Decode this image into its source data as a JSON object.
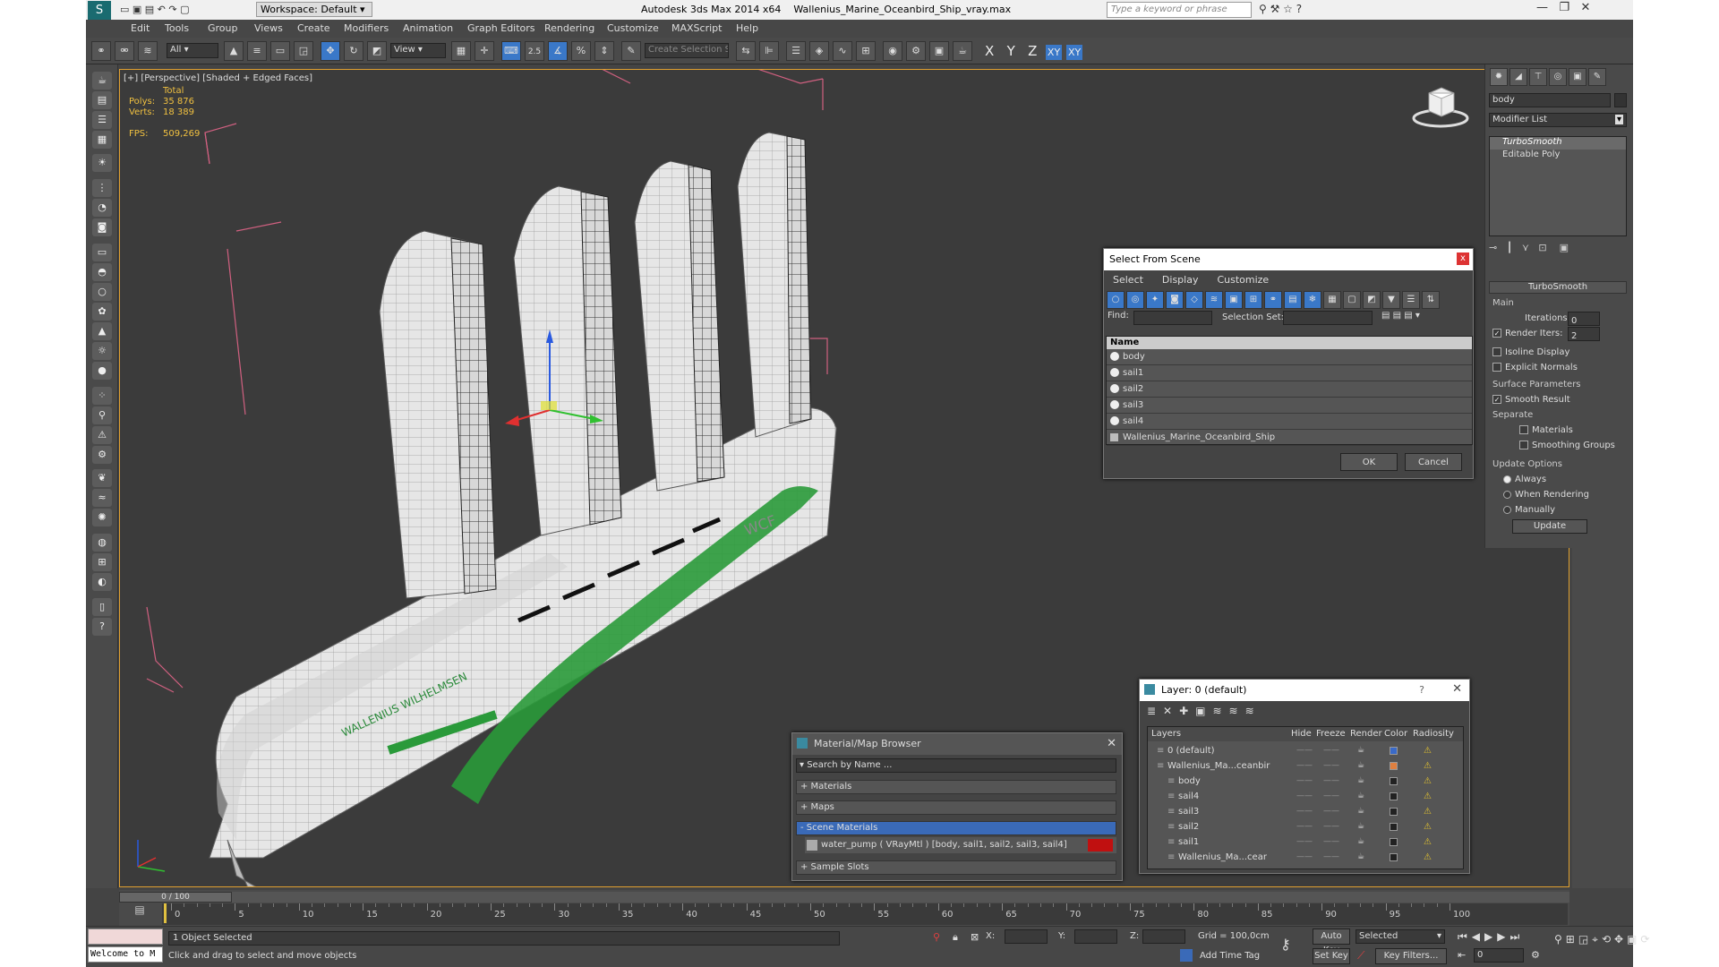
{
  "window": {
    "app_title": "Autodesk 3ds Max  2014 x64",
    "file_title": "Wallenius_Marine_Oceanbird_Ship_vray.max",
    "workspace": "Workspace: Default",
    "search_placeholder": "Type a keyword or phrase"
  },
  "menu": [
    "Edit",
    "Tools",
    "Group",
    "Views",
    "Create",
    "Modifiers",
    "Animation",
    "Graph Editors",
    "Rendering",
    "Customize",
    "MAXScript",
    "Help"
  ],
  "toolbar": {
    "filter": "All",
    "ref_coord": "View",
    "angle_snap": "2.5",
    "selection_set": "Create Selection Se",
    "axes": [
      "X",
      "Y",
      "Z",
      "XY",
      "XY"
    ]
  },
  "viewport": {
    "label": "[+] [Perspective] [Shaded + Edged Faces]",
    "stats": {
      "header": "Total",
      "polys_label": "Polys:",
      "polys": "35 876",
      "verts_label": "Verts:",
      "verts": "18 389",
      "fps_label": "FPS:",
      "fps": "509,269"
    },
    "logo_text": "WALLENIUS WILHELMSEN",
    "hull_text": "WCF"
  },
  "select_dialog": {
    "title": "Select From Scene",
    "tabs": [
      "Select",
      "Display",
      "Customize"
    ],
    "find_label": "Find:",
    "selset_label": "Selection Set:",
    "column": "Name",
    "items": [
      "body",
      "sail1",
      "sail2",
      "sail3",
      "sail4",
      "Wallenius_Marine_Oceanbird_Ship"
    ],
    "ok": "OK",
    "cancel": "Cancel"
  },
  "command_panel": {
    "object_name": "body",
    "modifier_list": "Modifier List",
    "stack": [
      "TurboSmooth",
      "Editable Poly"
    ],
    "rollout": "TurboSmooth",
    "main": "Main",
    "iterations_label": "Iterations:",
    "iterations": "0",
    "render_iters_label": "Render Iters:",
    "render_iters": "2",
    "isoline": "Isoline Display",
    "explicit_normals": "Explicit Normals",
    "surface_params": "Surface Parameters",
    "smooth_result": "Smooth Result",
    "separate": "Separate",
    "materials": "Materials",
    "smoothing_groups": "Smoothing Groups",
    "update_options": "Update Options",
    "always": "Always",
    "when_rendering": "When Rendering",
    "manually": "Manually",
    "update": "Update"
  },
  "material_browser": {
    "title": "Material/Map Browser",
    "search": "Search by Name ...",
    "sections": [
      "+ Materials",
      "+ Maps",
      "- Scene Materials",
      "+ Sample Slots"
    ],
    "material": "water_pump  ( VRayMtl ) [body, sail1, sail2, sail3, sail4]"
  },
  "layer_dialog": {
    "title": "Layer: 0 (default)",
    "help": "?",
    "columns": [
      "Layers",
      "Hide",
      "Freeze",
      "Render",
      "Color",
      "Radiosity"
    ],
    "rows": [
      {
        "name": "0 (default)",
        "color": "#3a6ac8"
      },
      {
        "name": "Wallenius_Ma...ceanbir",
        "color": "#e08040"
      },
      {
        "name": "body",
        "color": "#222222"
      },
      {
        "name": "sail4",
        "color": "#222222"
      },
      {
        "name": "sail3",
        "color": "#222222"
      },
      {
        "name": "sail2",
        "color": "#222222"
      },
      {
        "name": "sail1",
        "color": "#222222"
      },
      {
        "name": "Wallenius_Ma...cear",
        "color": "#222222"
      }
    ]
  },
  "timeline": {
    "frame": "0 / 100",
    "ticks": [
      "0",
      "5",
      "10",
      "15",
      "20",
      "25",
      "30",
      "35",
      "40",
      "45",
      "50",
      "55",
      "60",
      "65",
      "70",
      "75",
      "80",
      "85",
      "90",
      "95",
      "100"
    ]
  },
  "status": {
    "maxscript": "Welcome to M",
    "selected": "1 Object Selected",
    "prompt": "Click and drag to select and move objects",
    "x_label": "X:",
    "y_label": "Y:",
    "z_label": "Z:",
    "grid": "Grid = 100,0cm",
    "add_time_tag": "Add Time Tag",
    "auto_key": "Auto Key",
    "set_key": "Set Key",
    "selected_dd": "Selected",
    "key_filters": "Key Filters...",
    "frame": "0"
  }
}
